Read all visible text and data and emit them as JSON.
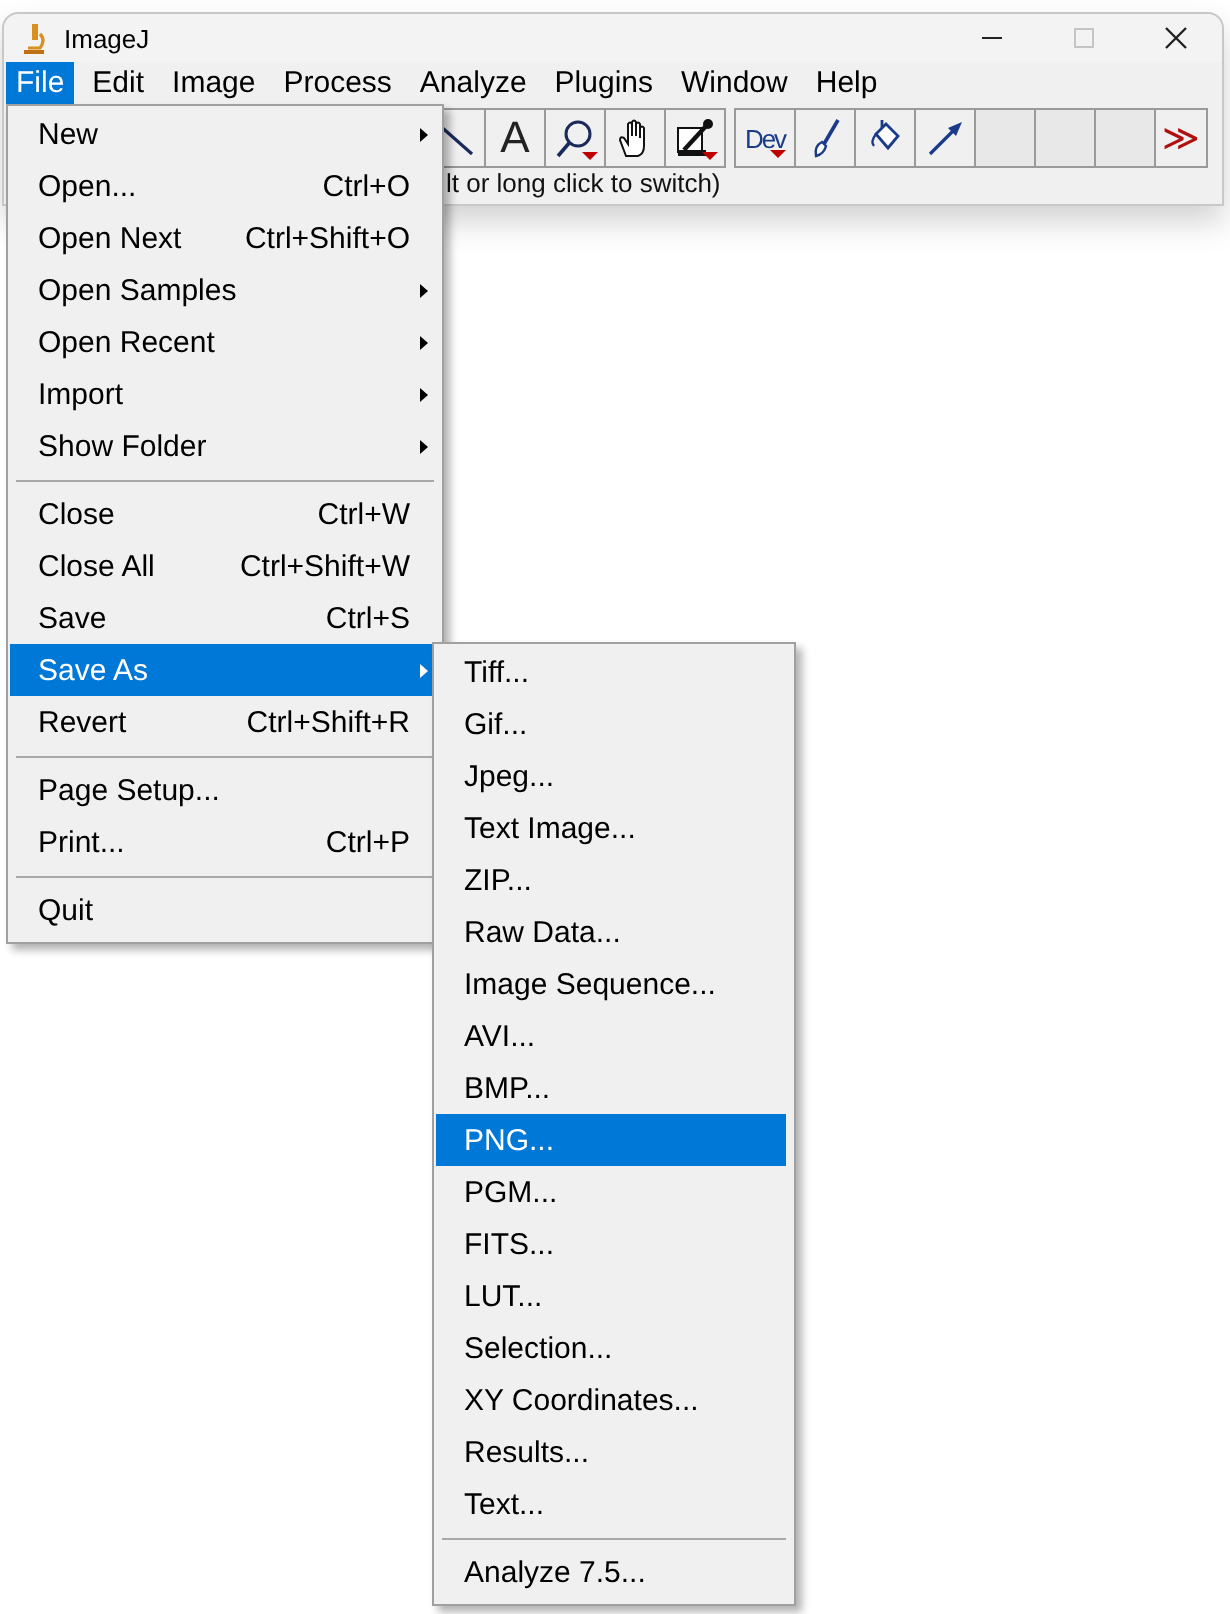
{
  "window": {
    "title": "ImageJ"
  },
  "menu_bar": [
    {
      "label": "File",
      "selected": true
    },
    {
      "label": "Edit",
      "selected": false
    },
    {
      "label": "Image",
      "selected": false
    },
    {
      "label": "Process",
      "selected": false
    },
    {
      "label": "Analyze",
      "selected": false
    },
    {
      "label": "Plugins",
      "selected": false
    },
    {
      "label": "Window",
      "selected": false
    },
    {
      "label": "Help",
      "selected": false
    }
  ],
  "toolbar": [
    {
      "kind": "wand"
    },
    {
      "kind": "text",
      "label": "A"
    },
    {
      "kind": "zoom"
    },
    {
      "kind": "hand"
    },
    {
      "kind": "dropper"
    },
    {
      "kind": "gap"
    },
    {
      "kind": "dev",
      "label": "Dev"
    },
    {
      "kind": "brush"
    },
    {
      "kind": "fill"
    },
    {
      "kind": "arrow"
    },
    {
      "kind": "empty"
    },
    {
      "kind": "empty"
    },
    {
      "kind": "empty"
    },
    {
      "kind": "more",
      "label": "≫"
    }
  ],
  "status_text": "lt or long click to switch)",
  "file_menu": [
    {
      "kind": "item",
      "label": "New",
      "submenu": true,
      "selected": false
    },
    {
      "kind": "item",
      "label": "Open...",
      "shortcut": "Ctrl+O",
      "submenu": false,
      "selected": false
    },
    {
      "kind": "item",
      "label": "Open Next",
      "shortcut": "Ctrl+Shift+O",
      "submenu": false,
      "selected": false
    },
    {
      "kind": "item",
      "label": "Open Samples",
      "submenu": true,
      "selected": false
    },
    {
      "kind": "item",
      "label": "Open Recent",
      "submenu": true,
      "selected": false
    },
    {
      "kind": "item",
      "label": "Import",
      "submenu": true,
      "selected": false
    },
    {
      "kind": "item",
      "label": "Show Folder",
      "submenu": true,
      "selected": false
    },
    {
      "kind": "separator"
    },
    {
      "kind": "item",
      "label": "Close",
      "shortcut": "Ctrl+W",
      "submenu": false,
      "selected": false
    },
    {
      "kind": "item",
      "label": "Close All",
      "shortcut": "Ctrl+Shift+W",
      "submenu": false,
      "selected": false
    },
    {
      "kind": "item",
      "label": "Save",
      "shortcut": "Ctrl+S",
      "submenu": false,
      "selected": false
    },
    {
      "kind": "item",
      "label": "Save As",
      "submenu": true,
      "selected": true
    },
    {
      "kind": "item",
      "label": "Revert",
      "shortcut": "Ctrl+Shift+R",
      "submenu": false,
      "selected": false
    },
    {
      "kind": "separator"
    },
    {
      "kind": "item",
      "label": "Page Setup...",
      "submenu": false,
      "selected": false
    },
    {
      "kind": "item",
      "label": "Print...",
      "shortcut": "Ctrl+P",
      "submenu": false,
      "selected": false
    },
    {
      "kind": "separator"
    },
    {
      "kind": "item",
      "label": "Quit",
      "submenu": false,
      "selected": false
    }
  ],
  "save_as_menu": [
    {
      "kind": "item",
      "label": "Tiff...",
      "selected": false
    },
    {
      "kind": "item",
      "label": "Gif...",
      "selected": false
    },
    {
      "kind": "item",
      "label": "Jpeg...",
      "selected": false
    },
    {
      "kind": "item",
      "label": "Text Image...",
      "selected": false
    },
    {
      "kind": "item",
      "label": "ZIP...",
      "selected": false
    },
    {
      "kind": "item",
      "label": "Raw Data...",
      "selected": false
    },
    {
      "kind": "item",
      "label": "Image Sequence...",
      "selected": false
    },
    {
      "kind": "item",
      "label": "AVI...",
      "selected": false
    },
    {
      "kind": "item",
      "label": "BMP...",
      "selected": false
    },
    {
      "kind": "item",
      "label": "PNG...",
      "selected": true
    },
    {
      "kind": "item",
      "label": "PGM...",
      "selected": false
    },
    {
      "kind": "item",
      "label": "FITS...",
      "selected": false
    },
    {
      "kind": "item",
      "label": "LUT...",
      "selected": false
    },
    {
      "kind": "item",
      "label": "Selection...",
      "selected": false
    },
    {
      "kind": "item",
      "label": "XY Coordinates...",
      "selected": false
    },
    {
      "kind": "item",
      "label": "Results...",
      "selected": false
    },
    {
      "kind": "item",
      "label": "Text...",
      "selected": false
    },
    {
      "kind": "separator"
    },
    {
      "kind": "item",
      "label": "Analyze 7.5...",
      "selected": false
    }
  ]
}
